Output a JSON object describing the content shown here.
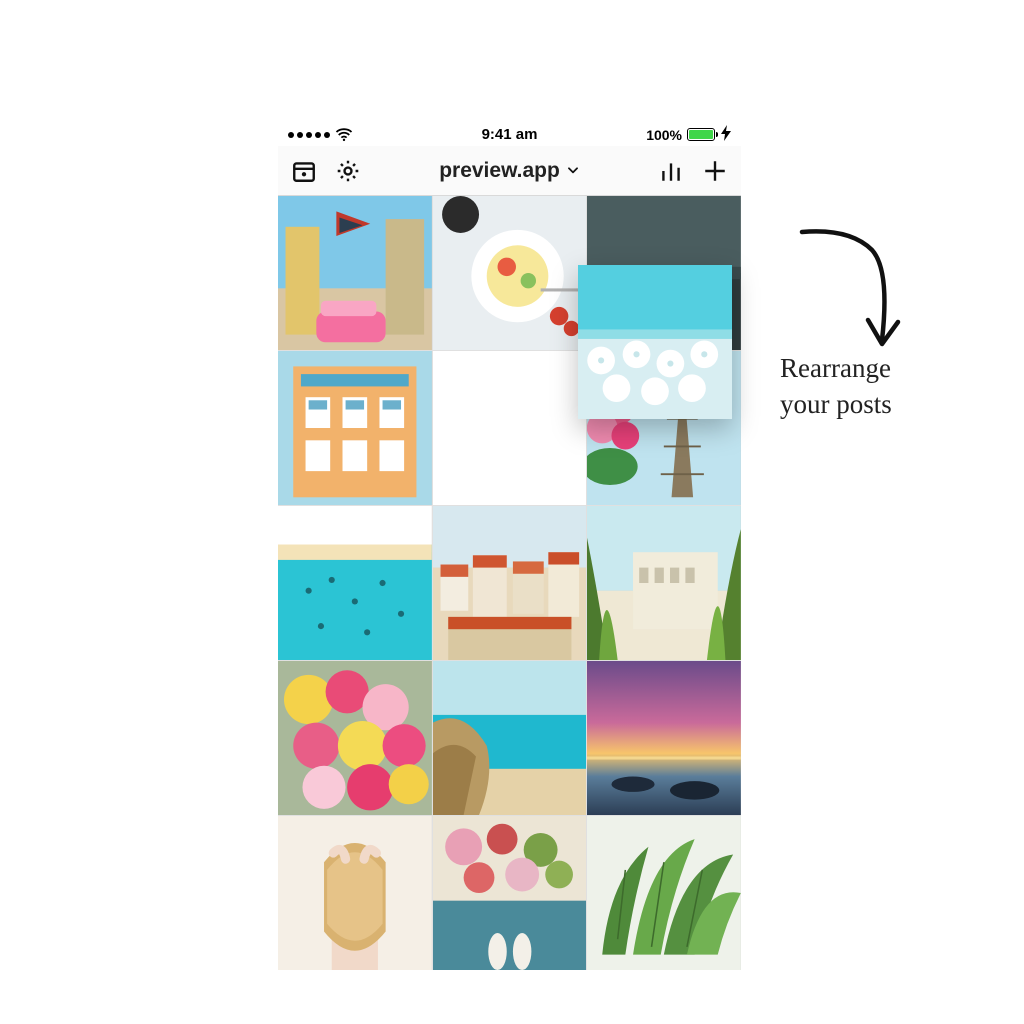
{
  "status": {
    "time": "9:41 am",
    "battery_percent": "100%"
  },
  "nav": {
    "title": "preview.app",
    "calendar_icon": "calendar-icon",
    "settings_icon": "gear-icon",
    "analytics_icon": "bar-chart-icon",
    "add_icon": "plus-icon"
  },
  "grid": {
    "tiles": [
      {
        "name": "street-flag-pink-car"
      },
      {
        "name": "breakfast-bowl-flatlay"
      },
      {
        "name": "dark-sea-horizon"
      },
      {
        "name": "orange-apartment-building"
      },
      {
        "name": "empty-slot"
      },
      {
        "name": "eiffel-tower-flowers"
      },
      {
        "name": "aerial-beach-people"
      },
      {
        "name": "hillside-town-red-roofs"
      },
      {
        "name": "palm-trees-white-building"
      },
      {
        "name": "flower-market"
      },
      {
        "name": "rocky-cove-turquoise"
      },
      {
        "name": "sunset-boats-purple"
      },
      {
        "name": "girl-back-blonde"
      },
      {
        "name": "food-overhead-feet"
      },
      {
        "name": "banana-leaves-green"
      }
    ],
    "dragged": {
      "name": "beach-umbrellas-white"
    }
  },
  "annotation": {
    "line1": "Rearrange",
    "line2": "your posts"
  }
}
